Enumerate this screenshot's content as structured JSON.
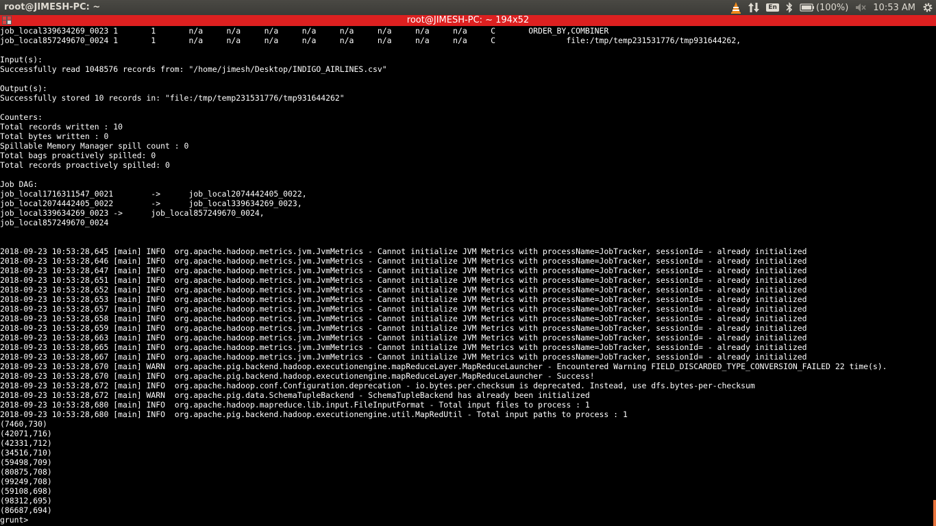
{
  "topbar": {
    "title": "root@JIMESH-PC: ~",
    "lang": "En",
    "battery": "(100%)",
    "clock": "10:53 AM"
  },
  "terminal": {
    "title": "root@JIMESH-PC: ~ 194x52",
    "lines": [
      "job_local339634269_0023 1       1       n/a     n/a     n/a     n/a     n/a     n/a     n/a     n/a     C       ORDER_BY,COMBINER",
      "job_local857249670_0024 1       1       n/a     n/a     n/a     n/a     n/a     n/a     n/a     n/a     C               file:/tmp/temp231531776/tmp931644262,",
      "",
      "Input(s):",
      "Successfully read 1048576 records from: \"/home/jimesh/Desktop/INDIGO_AIRLINES.csv\"",
      "",
      "Output(s):",
      "Successfully stored 10 records in: \"file:/tmp/temp231531776/tmp931644262\"",
      "",
      "Counters:",
      "Total records written : 10",
      "Total bytes written : 0",
      "Spillable Memory Manager spill count : 0",
      "Total bags proactively spilled: 0",
      "Total records proactively spilled: 0",
      "",
      "Job DAG:",
      "job_local1716311547_0021        ->      job_local2074442405_0022,",
      "job_local2074442405_0022        ->      job_local339634269_0023,",
      "job_local339634269_0023 ->      job_local857249670_0024,",
      "job_local857249670_0024",
      "",
      "",
      "2018-09-23 10:53:28,645 [main] INFO  org.apache.hadoop.metrics.jvm.JvmMetrics - Cannot initialize JVM Metrics with processName=JobTracker, sessionId= - already initialized",
      "2018-09-23 10:53:28,646 [main] INFO  org.apache.hadoop.metrics.jvm.JvmMetrics - Cannot initialize JVM Metrics with processName=JobTracker, sessionId= - already initialized",
      "2018-09-23 10:53:28,647 [main] INFO  org.apache.hadoop.metrics.jvm.JvmMetrics - Cannot initialize JVM Metrics with processName=JobTracker, sessionId= - already initialized",
      "2018-09-23 10:53:28,651 [main] INFO  org.apache.hadoop.metrics.jvm.JvmMetrics - Cannot initialize JVM Metrics with processName=JobTracker, sessionId= - already initialized",
      "2018-09-23 10:53:28,652 [main] INFO  org.apache.hadoop.metrics.jvm.JvmMetrics - Cannot initialize JVM Metrics with processName=JobTracker, sessionId= - already initialized",
      "2018-09-23 10:53:28,653 [main] INFO  org.apache.hadoop.metrics.jvm.JvmMetrics - Cannot initialize JVM Metrics with processName=JobTracker, sessionId= - already initialized",
      "2018-09-23 10:53:28,657 [main] INFO  org.apache.hadoop.metrics.jvm.JvmMetrics - Cannot initialize JVM Metrics with processName=JobTracker, sessionId= - already initialized",
      "2018-09-23 10:53:28,658 [main] INFO  org.apache.hadoop.metrics.jvm.JvmMetrics - Cannot initialize JVM Metrics with processName=JobTracker, sessionId= - already initialized",
      "2018-09-23 10:53:28,659 [main] INFO  org.apache.hadoop.metrics.jvm.JvmMetrics - Cannot initialize JVM Metrics with processName=JobTracker, sessionId= - already initialized",
      "2018-09-23 10:53:28,663 [main] INFO  org.apache.hadoop.metrics.jvm.JvmMetrics - Cannot initialize JVM Metrics with processName=JobTracker, sessionId= - already initialized",
      "2018-09-23 10:53:28,665 [main] INFO  org.apache.hadoop.metrics.jvm.JvmMetrics - Cannot initialize JVM Metrics with processName=JobTracker, sessionId= - already initialized",
      "2018-09-23 10:53:28,667 [main] INFO  org.apache.hadoop.metrics.jvm.JvmMetrics - Cannot initialize JVM Metrics with processName=JobTracker, sessionId= - already initialized",
      "2018-09-23 10:53:28,670 [main] WARN  org.apache.pig.backend.hadoop.executionengine.mapReduceLayer.MapReduceLauncher - Encountered Warning FIELD_DISCARDED_TYPE_CONVERSION_FAILED 22 time(s).",
      "2018-09-23 10:53:28,670 [main] INFO  org.apache.pig.backend.hadoop.executionengine.mapReduceLayer.MapReduceLauncher - Success!",
      "2018-09-23 10:53:28,672 [main] INFO  org.apache.hadoop.conf.Configuration.deprecation - io.bytes.per.checksum is deprecated. Instead, use dfs.bytes-per-checksum",
      "2018-09-23 10:53:28,672 [main] WARN  org.apache.pig.data.SchemaTupleBackend - SchemaTupleBackend has already been initialized",
      "2018-09-23 10:53:28,680 [main] INFO  org.apache.hadoop.mapreduce.lib.input.FileInputFormat - Total input files to process : 1",
      "2018-09-23 10:53:28,680 [main] INFO  org.apache.pig.backend.hadoop.executionengine.util.MapRedUtil - Total input paths to process : 1",
      "(7460,730)",
      "(42071,716)",
      "(42331,712)",
      "(34516,710)",
      "(59498,709)",
      "(80875,708)",
      "(99249,708)",
      "(59108,698)",
      "(98312,695)",
      "(86687,694)",
      "grunt>"
    ]
  }
}
